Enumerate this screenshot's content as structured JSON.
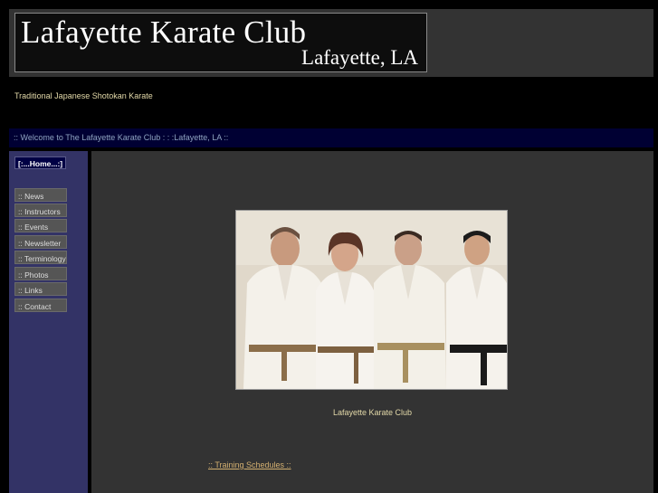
{
  "header": {
    "title": "Lafayette Karate Club",
    "location": "Lafayette, LA",
    "tagline": "Traditional Japanese Shotokan Karate"
  },
  "welcome": ":: Welcome to The Lafayette Karate Club : : :Lafayette, LA ::",
  "sidebar": {
    "home": "[:...Home...:]",
    "items": [
      {
        "label": ":: News"
      },
      {
        "label": ":: Instructors"
      },
      {
        "label": ":: Events"
      },
      {
        "label": ":: Newsletter"
      },
      {
        "label": ":: Terminology"
      },
      {
        "label": ":: Photos"
      },
      {
        "label": ":: Links"
      },
      {
        "label": ":: Contact"
      }
    ]
  },
  "main": {
    "photo_caption": "Lafayette Karate Club",
    "schedule_link": ":: Training Schedules ::"
  }
}
